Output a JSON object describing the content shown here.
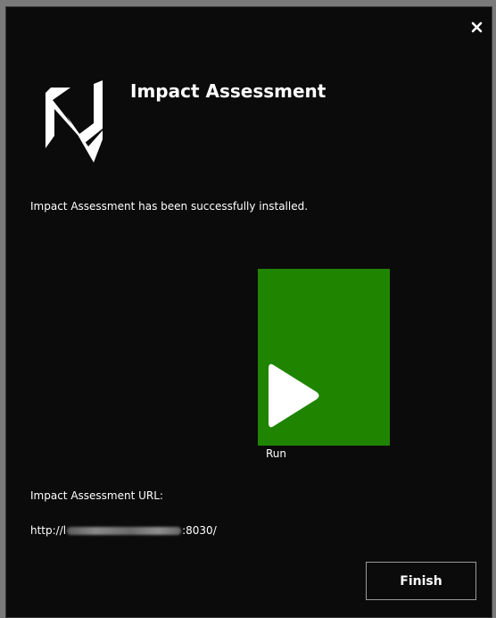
{
  "window": {
    "title": "Impact Assessment",
    "close_icon": "close-icon",
    "logo_icon": "app-logo-icon"
  },
  "message": "Impact Assessment has been successfully installed.",
  "run": {
    "label": "Run",
    "icon": "play-icon",
    "tile_color": "#1f8400"
  },
  "url": {
    "label": "Impact Assessment URL:",
    "prefix": "http://l",
    "suffix": ":8030/"
  },
  "buttons": {
    "finish_label": "Finish"
  },
  "colors": {
    "background": "#0b0b0b",
    "text": "#ffffff",
    "accent": "#1f8400"
  }
}
